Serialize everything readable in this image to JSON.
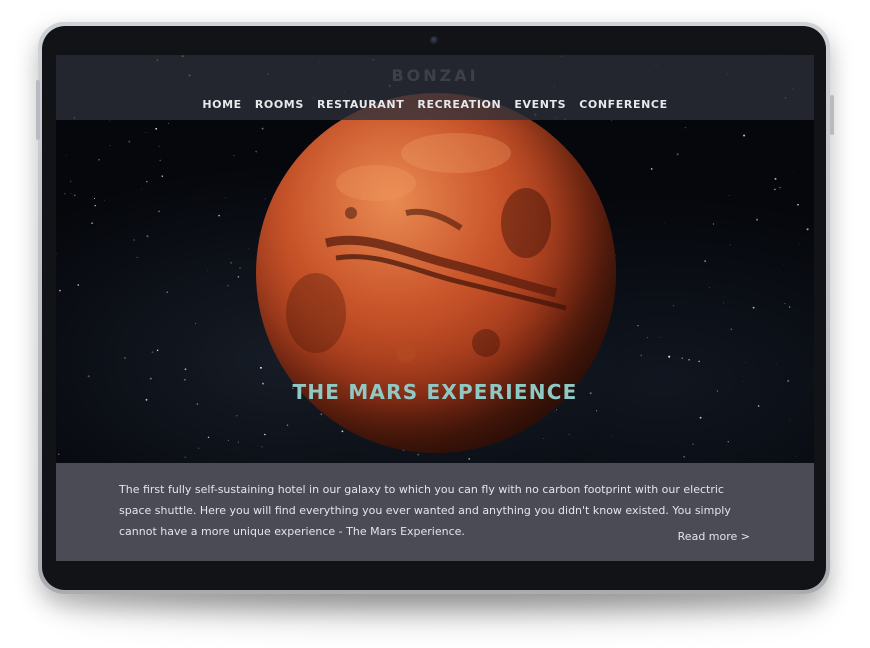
{
  "site": {
    "logo": "BONZAI"
  },
  "nav": {
    "items": [
      {
        "label": "HOME"
      },
      {
        "label": "ROOMS"
      },
      {
        "label": "RESTAURANT"
      },
      {
        "label": "RECREATION"
      },
      {
        "label": "EVENTS"
      },
      {
        "label": "CONFERENCE"
      }
    ]
  },
  "hero": {
    "title": "THE MARS EXPERIENCE"
  },
  "info": {
    "description": "The first fully self-sustaining hotel in our galaxy to which you can fly with no carbon footprint with our electric space shuttle. Here you will find everything you ever wanted and anything you didn't know existed. You simply cannot have a more unique experience - The Mars Experience.",
    "read_more": "Read more >"
  },
  "colors": {
    "accent": "#8fc9c6",
    "panel": "#4a4b55",
    "nav_text": "#e6e8ec"
  }
}
